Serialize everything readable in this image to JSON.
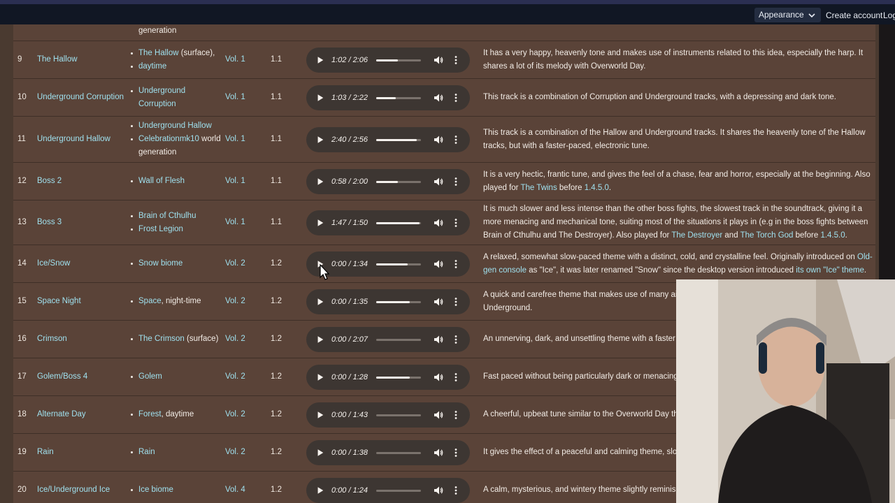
{
  "header": {
    "appearance_label": "Appearance",
    "create_account_label": "Create account",
    "login_label": "Log"
  },
  "top_partial": {
    "biome_text": "generation"
  },
  "rows": [
    {
      "num": "9",
      "name": "The Hallow",
      "biomes": [
        {
          "link": "The Hallow",
          "suffix": " (surface),"
        },
        {
          "link": "daytime",
          "suffix": ""
        }
      ],
      "vol": "Vol. 1",
      "ver": "1.1",
      "time": "1:02 / 2:06",
      "progress": 0.49,
      "desc": [
        {
          "t": "It has a very happy, heavenly tone and makes use of instruments related to this idea, especially the harp. It shares a lot of its melody with Overworld Day."
        }
      ]
    },
    {
      "num": "10",
      "name": "Underground Corruption",
      "biomes": [
        {
          "link": "Underground Corruption",
          "suffix": ""
        }
      ],
      "vol": "Vol. 1",
      "ver": "1.1",
      "time": "1:03 / 2:22",
      "progress": 0.44,
      "desc": [
        {
          "t": "This track is a combination of Corruption and Underground tracks, with a depressing and dark tone."
        }
      ]
    },
    {
      "num": "11",
      "name": "Underground Hallow",
      "biomes": [
        {
          "link": "Underground Hallow",
          "suffix": ""
        },
        {
          "link": "Celebrationmk10",
          "suffix": " world generation"
        }
      ],
      "vol": "Vol. 1",
      "ver": "1.1",
      "time": "2:40 / 2:56",
      "progress": 0.91,
      "desc": [
        {
          "t": "This track is a combination of the Hallow and Underground tracks. It shares the heavenly tone of the Hallow tracks, but with a faster-paced, electronic tune."
        }
      ]
    },
    {
      "num": "12",
      "name": "Boss 2",
      "biomes": [
        {
          "link": "Wall of Flesh",
          "suffix": ""
        }
      ],
      "vol": "Vol. 1",
      "ver": "1.1",
      "time": "0:58 / 2:00",
      "progress": 0.48,
      "desc": [
        {
          "t": "It is a very hectic, frantic tune, and gives the feel of a chase, fear and horror, especially at the beginning. Also played for "
        },
        {
          "l": "The Twins"
        },
        {
          "t": " before "
        },
        {
          "l": "1.4.5.0"
        },
        {
          "t": "."
        }
      ]
    },
    {
      "num": "13",
      "name": "Boss 3",
      "biomes": [
        {
          "link": "Brain of Cthulhu",
          "suffix": ""
        },
        {
          "link": "Frost Legion",
          "suffix": ""
        }
      ],
      "vol": "Vol. 1",
      "ver": "1.1",
      "time": "1:47 / 1:50",
      "progress": 0.97,
      "desc": [
        {
          "t": "It is much slower and less intense than the other boss fights, the slowest track in the soundtrack, giving it a more menacing and mechanical tone, suiting most of the situations it plays in (e.g in the boss fights between Brain of Cthulhu and The Destroyer). Also played for "
        },
        {
          "l": "The Destroyer"
        },
        {
          "t": " and "
        },
        {
          "l": "The Torch God"
        },
        {
          "t": " before "
        },
        {
          "l": "1.4.5.0"
        },
        {
          "t": "."
        }
      ]
    },
    {
      "num": "14",
      "name": "Ice/Snow",
      "biomes": [
        {
          "link": "Snow biome",
          "suffix": ""
        }
      ],
      "vol": "Vol. 2",
      "ver": "1.2",
      "time": "0:00 / 1:34",
      "progress": 0.7,
      "desc": [
        {
          "t": "A relaxed, somewhat slow-paced theme with a distinct, cold, and crystalline feel. Originally introduced on "
        },
        {
          "l": "Old-gen console"
        },
        {
          "t": " as \"Ice\", it was later renamed \"Snow\" since the desktop version introduced "
        },
        {
          "l": "its own \"Ice\" theme"
        },
        {
          "t": "."
        }
      ]
    },
    {
      "num": "15",
      "name": "Space Night",
      "biomes": [
        {
          "link": "Space",
          "suffix": ", night-time"
        }
      ],
      "vol": "Vol. 2",
      "ver": "1.2",
      "time": "0:00 / 1:35",
      "progress": 0.75,
      "desc": [
        {
          "t": "A quick and carefree theme that makes use of many airy Overworld Day theme. Contains a motif of Underground."
        }
      ]
    },
    {
      "num": "16",
      "name": "Crimson",
      "biomes": [
        {
          "link": "The Crimson",
          "suffix": " (surface)"
        }
      ],
      "vol": "Vol. 2",
      "ver": "1.2",
      "time": "0:00 / 2:07",
      "progress": 0.0,
      "desc": [
        {
          "t": "An unnerving, dark, and unsettling theme with a faster pa near the end of the track."
        }
      ]
    },
    {
      "num": "17",
      "name": "Golem/Boss 4",
      "biomes": [
        {
          "link": "Golem",
          "suffix": ""
        }
      ],
      "vol": "Vol. 2",
      "ver": "1.2",
      "time": "0:00 / 1:28",
      "progress": 0.75,
      "desc": [
        {
          "t": "Fast paced without being particularly dark or menacing. A"
        }
      ]
    },
    {
      "num": "18",
      "name": "Alternate Day",
      "biomes": [
        {
          "link": "Forest",
          "suffix": ", daytime"
        }
      ],
      "vol": "Vol. 2",
      "ver": "1.2",
      "time": "0:00 / 1:43",
      "progress": 0.0,
      "desc": [
        {
          "t": "A cheerful, upbeat tune similar to the Overworld Day ther"
        }
      ]
    },
    {
      "num": "19",
      "name": "Rain",
      "biomes": [
        {
          "link": "Rain",
          "suffix": ""
        }
      ],
      "vol": "Vol. 2",
      "ver": "1.2",
      "time": "0:00 / 1:38",
      "progress": 0.0,
      "desc": [
        {
          "t": "It gives the effect of a peaceful and calming theme, slowe"
        }
      ]
    },
    {
      "num": "20",
      "name": "Ice/Underground Ice",
      "biomes": [
        {
          "link": "Ice biome",
          "suffix": ""
        }
      ],
      "vol": "Vol. 4",
      "ver": "1.2",
      "time": "0:00 / 1:24",
      "progress": 0.0,
      "desc": [
        {
          "t": "A calm, mysterious, and wintery theme slightly reminisce"
        }
      ]
    }
  ],
  "icons": {
    "play": "play-icon",
    "volume": "volume-icon",
    "more": "more-vertical-icon",
    "chevron": "chevron-down-icon",
    "cursor": "mouse-cursor-icon"
  },
  "colors": {
    "page_bg": "#5a4338",
    "header_bg": "#111724",
    "link": "#9fe0ee",
    "player_bg": "#3d3632"
  }
}
